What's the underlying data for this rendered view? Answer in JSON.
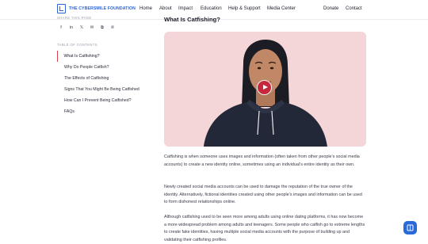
{
  "header": {
    "logo_text": "THE CYBERSMILE FOUNDATION",
    "nav": [
      "Home",
      "About",
      "Impact",
      "Education",
      "Help & Support",
      "Media Center"
    ],
    "right_nav": [
      "Donate",
      "Contact"
    ]
  },
  "sidebar": {
    "share_label": "SHARE THIS PAGE",
    "share_icons": [
      "facebook-icon",
      "linkedin-icon",
      "x-icon",
      "email-icon",
      "copy-link-icon",
      "pinterest-icon"
    ],
    "share_glyphs": [
      "f",
      "in",
      "𝕏",
      "✉",
      "⧉",
      "℗"
    ],
    "toc_label": "TABLE OF CONTENTS",
    "toc": [
      "What Is Catfishing?",
      "Why Do People Catfish?",
      "The Effects of Catfishing",
      "Signs That You Might Be Being Catfished",
      "How Can I Prevent Being Catfished?",
      "FAQs"
    ],
    "active_index": 0
  },
  "main": {
    "title": "What Is Catfishing?",
    "paragraphs": [
      "Catfishing is when someone uses images and information (often taken from other people’s social media accounts) to create a new identity online, sometimes using an individual’s entire identity as their own.",
      "Newly created social media accounts can be used to damage the reputation of the true owner of the identity. Alternatively, fictional identities created using other people’s images and information can be used to form dishonest relationships online.",
      "Although catfishing used to be seen more among adults using online dating platforms, it has now become a more widespread problem among adults and teenagers. Some people who catfish go to extreme lengths to create fake identities, having multiple social media accounts with the purpose of building up and validating their catfishing profiles."
    ]
  },
  "colors": {
    "brand": "#2c64d6",
    "accent": "#d9404a",
    "hero_bg": "#f4d6d9",
    "play": "#c6283c",
    "help_button": "#2a6ad8"
  }
}
